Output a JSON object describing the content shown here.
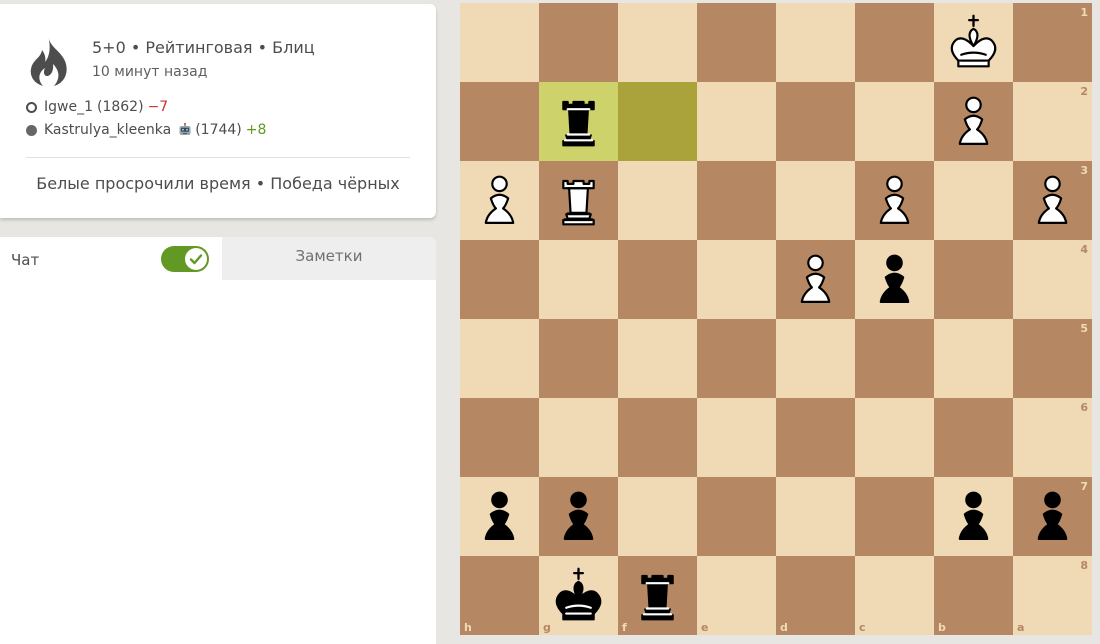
{
  "game": {
    "setup": "5+0 • Рейтинговая • Блиц",
    "time_ago": "10 минут назад",
    "white_player": {
      "name": "Igwe_1",
      "rating": "(1862)",
      "diff": "−7"
    },
    "black_player": {
      "name": "Kastrulya_kleenka",
      "rating": "(1744)",
      "diff": "+8"
    },
    "result": "Белые просрочили время • Победа чёрных"
  },
  "chat": {
    "tab_chat_label": "Чат",
    "tab_notes_label": "Заметки",
    "chat_enabled": true
  },
  "colors": {
    "accent_green": "#629924",
    "loss_red": "#cc3333",
    "light_square": "#f0d9b5",
    "dark_square": "#b58863",
    "last_move_light": "#cdd26a",
    "last_move_dark": "#aaa23a"
  },
  "board": {
    "orientation": "black",
    "files": [
      "h",
      "g",
      "f",
      "e",
      "d",
      "c",
      "b",
      "a"
    ],
    "ranks": [
      "1",
      "2",
      "3",
      "4",
      "5",
      "6",
      "7",
      "8"
    ],
    "last_move": [
      "g2",
      "f2"
    ],
    "pieces": [
      {
        "square": "b1",
        "color": "white",
        "type": "king"
      },
      {
        "square": "g2",
        "color": "black",
        "type": "rook"
      },
      {
        "square": "b2",
        "color": "white",
        "type": "pawn"
      },
      {
        "square": "h3",
        "color": "white",
        "type": "pawn"
      },
      {
        "square": "g3",
        "color": "white",
        "type": "rook"
      },
      {
        "square": "c3",
        "color": "white",
        "type": "pawn"
      },
      {
        "square": "a3",
        "color": "white",
        "type": "pawn"
      },
      {
        "square": "d4",
        "color": "white",
        "type": "pawn"
      },
      {
        "square": "c4",
        "color": "black",
        "type": "pawn"
      },
      {
        "square": "h7",
        "color": "black",
        "type": "pawn"
      },
      {
        "square": "g7",
        "color": "black",
        "type": "pawn"
      },
      {
        "square": "b7",
        "color": "black",
        "type": "pawn"
      },
      {
        "square": "a7",
        "color": "black",
        "type": "pawn"
      },
      {
        "square": "g8",
        "color": "black",
        "type": "king"
      },
      {
        "square": "f8",
        "color": "black",
        "type": "rook"
      }
    ]
  }
}
